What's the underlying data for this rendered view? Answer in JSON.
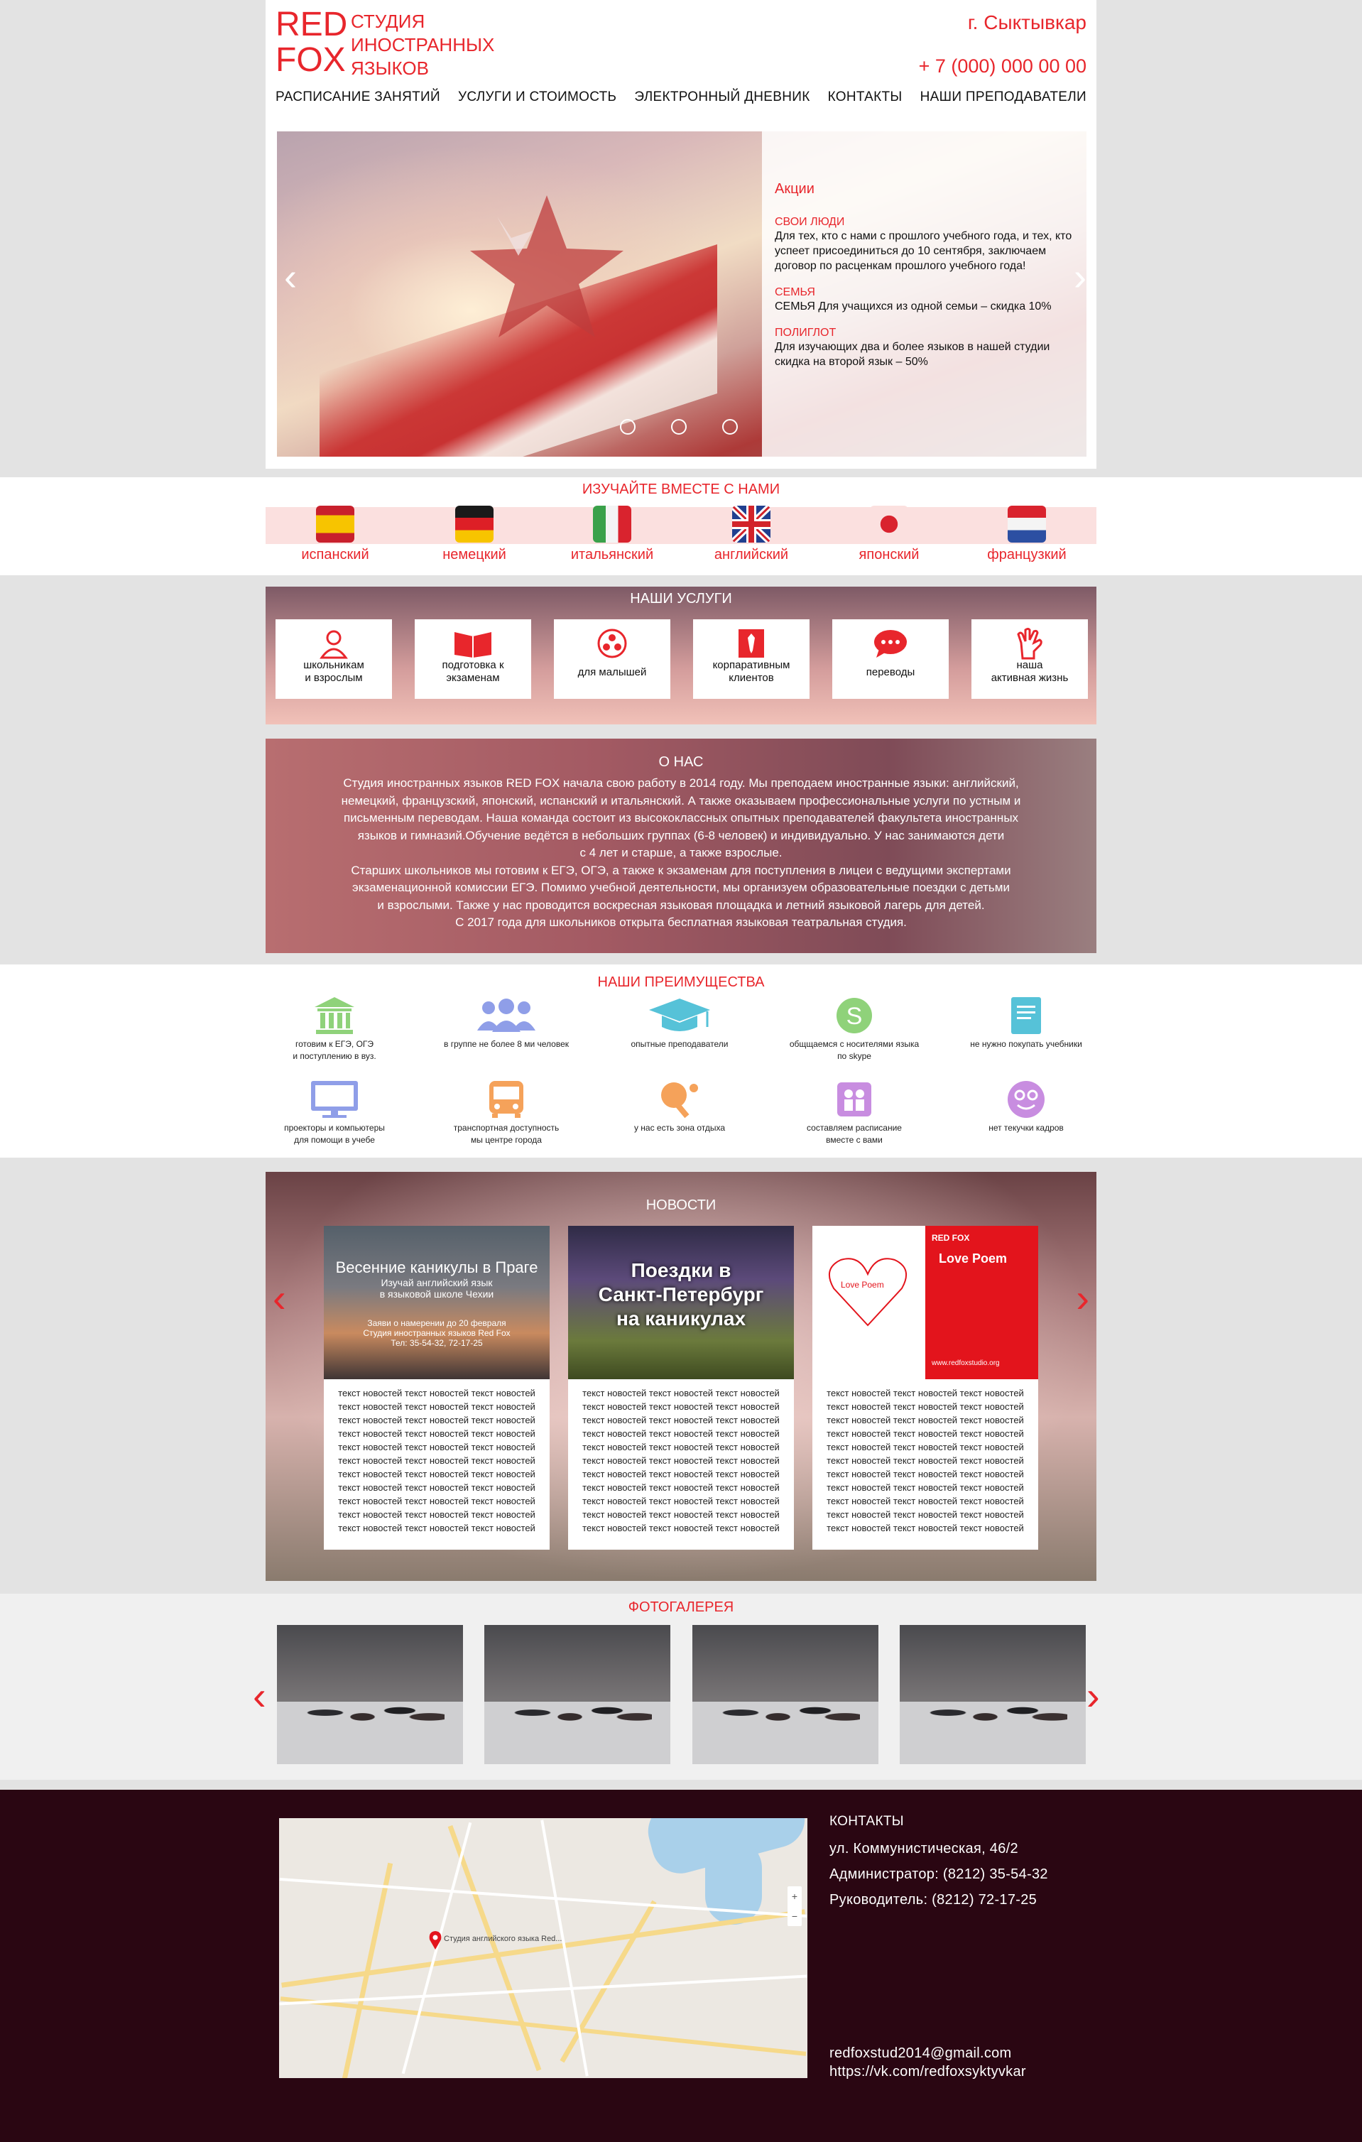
{
  "header": {
    "logo_main_1": "RED",
    "logo_main_2": "FOX",
    "logo_sub_1": "СТУДИЯ",
    "logo_sub_2": "ИНОСТРАННЫХ",
    "logo_sub_3": "ЯЗЫКОВ",
    "city": "г. Сыктывкар",
    "phone": "+ 7 (000) 000 00 00"
  },
  "nav": {
    "items": [
      "РАСПИСАНИЕ ЗАНЯТИЙ",
      "УСЛУГИ И СТОИМОСТЬ",
      "ЭЛЕКТРОННЫЙ ДНЕВНИК",
      "КОНТАКТЫ",
      "НАШИ ПРЕПОДАВАТЕЛИ"
    ]
  },
  "slider": {
    "promo_title": "Акции",
    "promos": [
      {
        "title": "СВОИ ЛЮДИ",
        "text": "Для тех, кто с нами с прошлого учебного года, и тех, кто успеет присоединиться до 10 сентября, заключаем договор по расценкам прошлого учебного года!"
      },
      {
        "title": "СЕМЬЯ",
        "text": "СЕМЬЯ Для учащихся из одной семьи – скидка 10%"
      },
      {
        "title": "ПОЛИГЛОТ",
        "text": "Для изучающих два и более языков в нашей студии скидка на второй язык – 50%"
      }
    ],
    "prev_arrow": "‹",
    "next_arrow": "›"
  },
  "languages": {
    "title": "ИЗУЧАЙТЕ ВМЕСТЕ С НАМИ",
    "items": [
      "испанский",
      "немецкий",
      "итальянский",
      "английский",
      "японский",
      "французкий"
    ]
  },
  "services": {
    "title": "НАШИ УСЛУГИ",
    "items": [
      {
        "line1": "школьникам",
        "line2": "и взрослым",
        "icon": "person-icon"
      },
      {
        "line1": "подготовка к",
        "line2": "экзаменам",
        "icon": "book-icon"
      },
      {
        "line1": "для малышей",
        "line2": "",
        "icon": "ball-icon"
      },
      {
        "line1": "корпаративным",
        "line2": "клиентов",
        "icon": "tie-icon"
      },
      {
        "line1": "переводы",
        "line2": "",
        "icon": "chat-icon"
      },
      {
        "line1": "наша",
        "line2": "активная жизнь",
        "icon": "hand-icon"
      }
    ]
  },
  "about": {
    "title": "О НАС",
    "lines": [
      "Студия иностранных языков RED FOX начала свою работу в 2014 году. Мы преподаем иностранные языки: английский,",
      "немецкий, французский, японский, испанский и итальянский. А также оказываем профессиональные услуги по устным и",
      "письменным переводам. Наша команда состоит из высококлассных опытных преподавателей факультета  иностранных",
      "языков и гимназий.Обучение ведётся в небольших группах (6-8 человек) и индивидуально. У нас занимаются дети",
      "с 4 лет и старше, а также взрослые.",
      "Старших школьников мы готовим к ЕГЭ, ОГЭ, а также к экзаменам для поступления в лицеи с ведущими экспертами",
      "экзаменационной комиссии ЕГЭ. Помимо учебной деятельности, мы организуем образовательные поездки с детьми",
      "и взрослыми. Также у нас проводится воскресная языковая площадка и летний языковой лагерь для детей.",
      "С 2017 года для школьников открыта бесплатная языковая театральная студия."
    ]
  },
  "advantages": {
    "title": "НАШИ ПРЕИМУЩЕСТВА",
    "items": [
      {
        "l1": "готовим к ЕГЭ, ОГЭ",
        "l2": "и поступлению в вуз.",
        "icon": "bank-icon",
        "color": "#8fd27a"
      },
      {
        "l1": "в группе не более 8 ми человек",
        "l2": "",
        "icon": "group-icon",
        "color": "#8f9ee8"
      },
      {
        "l1": "опытные преподаватели",
        "l2": "",
        "icon": "graduation-cap-icon",
        "color": "#56c2d8"
      },
      {
        "l1": "общщаемся с носителями языка",
        "l2": "по skype",
        "icon": "skype-icon",
        "color": "#8fd27a"
      },
      {
        "l1": "не нужно покупать учебники",
        "l2": "",
        "icon": "textbook-icon",
        "color": "#56c2d8"
      },
      {
        "l1": "проекторы и компьютеры",
        "l2": "для помощи в учебе",
        "icon": "monitor-icon",
        "color": "#8f9ee8"
      },
      {
        "l1": "транспортная доступность",
        "l2": "мы центре города",
        "icon": "bus-icon",
        "color": "#f5a25a"
      },
      {
        "l1": "у нас есть зона отдыха",
        "l2": "",
        "icon": "ping-pong-icon",
        "color": "#f5a25a"
      },
      {
        "l1": "составляем расписание",
        "l2": "вместе с вами",
        "icon": "people-icon",
        "color": "#c88de0"
      },
      {
        "l1": "нет текучки кадров",
        "l2": "",
        "icon": "smile-icon",
        "color": "#c88de0"
      }
    ]
  },
  "news": {
    "title": "НОВОСТИ",
    "card1_img_t1": "Весенние каникулы в Праге",
    "card1_img_t2": "Изучай английский язык",
    "card1_img_t3": "в языковой школе Чехии",
    "card1_img_t4": "Заяви о намерении до 20 февраля",
    "card1_img_t5": "Студия иностранных языков Red Fox",
    "card1_img_t6": "Тел: 35-54-32, 72-17-25",
    "card2_img_t1": "Поездки в",
    "card2_img_t2": "Санкт-Петербург",
    "card2_img_t3": "на каникулах",
    "card3_img_t1": "Love Poem",
    "card3_img_t2": "RED FOX",
    "card3_img_t3": "Love Poem",
    "card3_img_t4": "www.redfoxstudio.org",
    "text_line": "текст новостей текст новостей текст новостей",
    "lines_per_card": 11
  },
  "gallery": {
    "title": "ФОТОГАЛЕРЕЯ"
  },
  "contacts": {
    "title": "КОНТАКТЫ",
    "address": "ул. Коммунистическая, 46/2",
    "admin": "Администратор: (8212) 35-54-32",
    "head": "Руководитель: (8212) 72-17-25",
    "email": "redfoxstud2014@gmail.com",
    "vk": "https://vk.com/redfoxsyktyvkar",
    "map_label": "Студия английского языка Red..."
  },
  "colors": {
    "accent": "#e8262c",
    "footer_bg": "#2a0612"
  }
}
